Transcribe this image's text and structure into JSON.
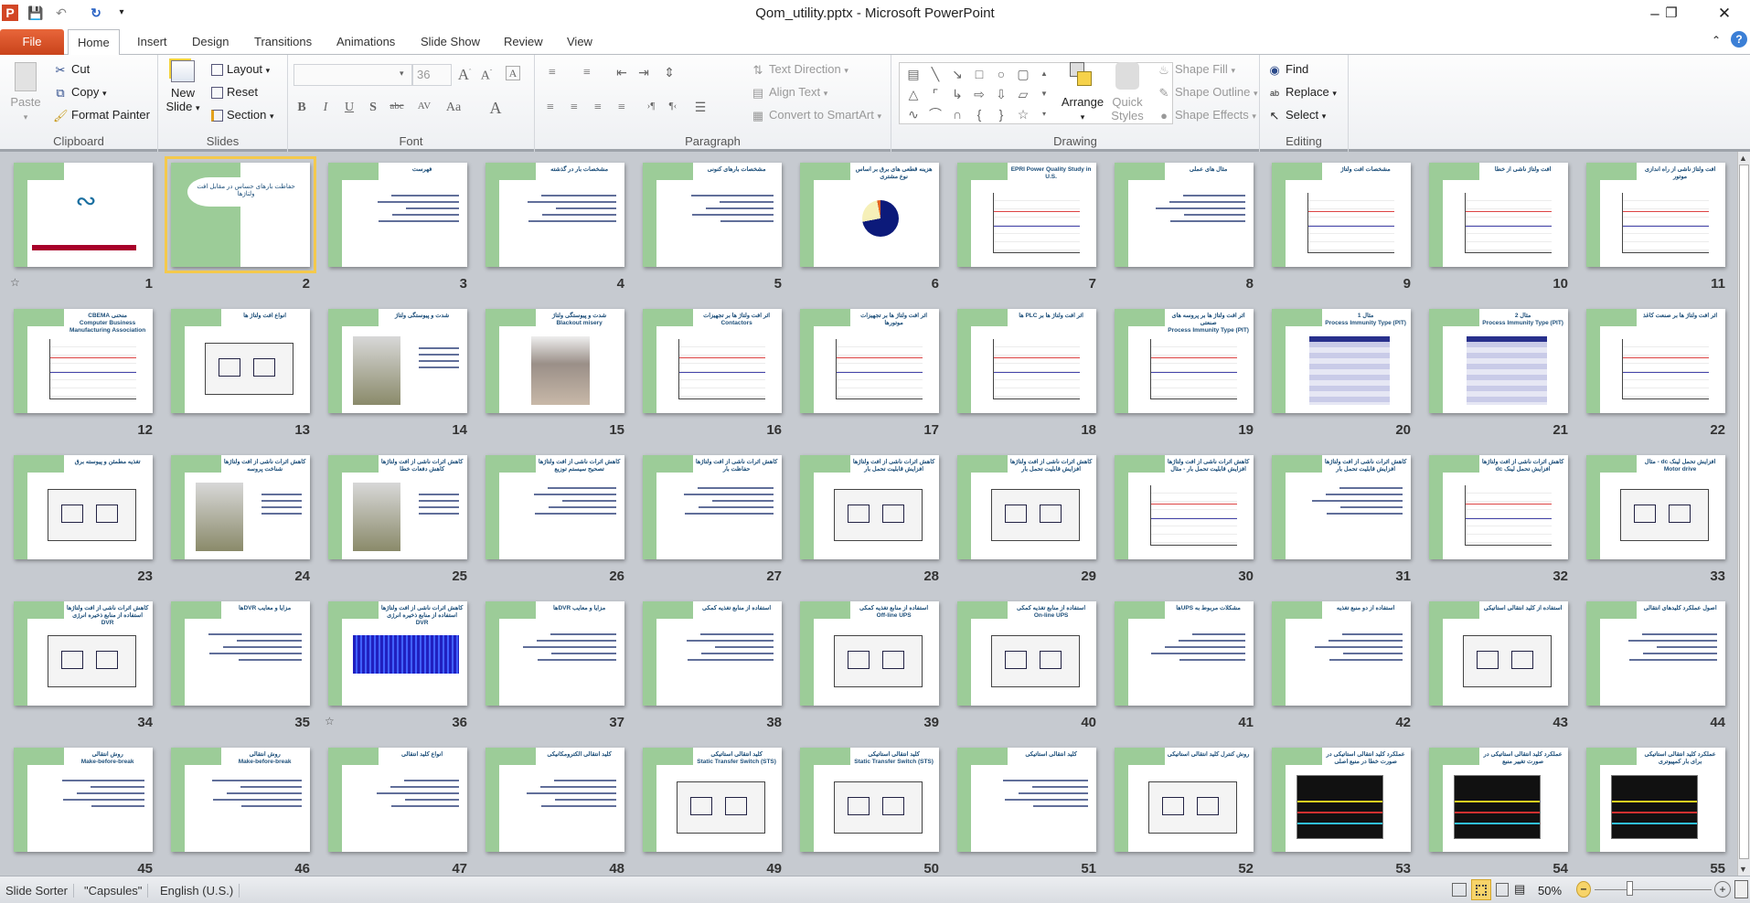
{
  "window": {
    "title": "Qom_utility.pptx - Microsoft PowerPoint",
    "controls": [
      "minimize",
      "restore",
      "close"
    ]
  },
  "qat": {
    "icons": [
      "powerpoint-logo-icon",
      "save-icon",
      "undo-icon",
      "redo-icon",
      "customize-qat-icon"
    ]
  },
  "tabs": [
    {
      "label": "File"
    },
    {
      "label": "Home",
      "active": true
    },
    {
      "label": "Insert"
    },
    {
      "label": "Design"
    },
    {
      "label": "Transitions"
    },
    {
      "label": "Animations"
    },
    {
      "label": "Slide Show"
    },
    {
      "label": "Review"
    },
    {
      "label": "View"
    }
  ],
  "ribbon": {
    "clipboard": {
      "label": "Clipboard",
      "paste": "Paste",
      "cut": "Cut",
      "copy": "Copy",
      "format_painter": "Format Painter"
    },
    "slides": {
      "label": "Slides",
      "new_slide_1": "New",
      "new_slide_2": "Slide",
      "layout": "Layout",
      "reset": "Reset",
      "section": "Section"
    },
    "font": {
      "label": "Font",
      "font_name": "",
      "font_size": "36"
    },
    "paragraph": {
      "label": "Paragraph",
      "text_direction": "Text Direction",
      "align_text": "Align Text",
      "convert_smartart": "Convert to SmartArt"
    },
    "drawing": {
      "label": "Drawing",
      "arrange": "Arrange",
      "quick_1": "Quick",
      "quick_2": "Styles",
      "shape_fill": "Shape Fill",
      "shape_outline": "Shape Outline",
      "shape_effects": "Shape Effects"
    },
    "editing": {
      "label": "Editing",
      "find": "Find",
      "replace": "Replace",
      "select": "Select"
    }
  },
  "slides": [
    {
      "n": "1",
      "title": "",
      "sub": "",
      "anim": true
    },
    {
      "n": "2",
      "title": "حفاظت بارهای حساس در مقابل افت ولتاژها",
      "sub": "",
      "selected": true
    },
    {
      "n": "3",
      "title": "فهرست",
      "sub": ""
    },
    {
      "n": "4",
      "title": "مشخصات بار در گذشته",
      "sub": ""
    },
    {
      "n": "5",
      "title": "مشخصات بارهای کنونی",
      "sub": ""
    },
    {
      "n": "6",
      "title": "هزینه قطعی های برق بر اساس نوع مشتری",
      "sub": ""
    },
    {
      "n": "7",
      "title": "",
      "sub": "EPRI Power Quality Study in U.S."
    },
    {
      "n": "8",
      "title": "مثال های عملی",
      "sub": ""
    },
    {
      "n": "9",
      "title": "مشخصات افت ولتاژ",
      "sub": ""
    },
    {
      "n": "10",
      "title": "افت ولتاژ ناشی از خطا",
      "sub": ""
    },
    {
      "n": "11",
      "title": "افت ولتاژ ناشی از راه اندازی موتور",
      "sub": ""
    },
    {
      "n": "12",
      "title": "منحنی CBEMA",
      "sub": "Computer Business Manufacturing Association"
    },
    {
      "n": "13",
      "title": "انواع افت ولتاژ ها",
      "sub": ""
    },
    {
      "n": "14",
      "title": "شدت و پیوستگی ولتاژ",
      "sub": ""
    },
    {
      "n": "15",
      "title": "شدت و پیوستگی ولتاژ",
      "sub": "Blackout misery"
    },
    {
      "n": "16",
      "title": "اثر افت ولتاژ ها بر تجهیزات",
      "sub": "Contactors"
    },
    {
      "n": "17",
      "title": "اثر افت ولتاژ ها بر تجهیزات موتورها",
      "sub": ""
    },
    {
      "n": "18",
      "title": "اثر افت ولتاژ ها بر PLC ها",
      "sub": ""
    },
    {
      "n": "19",
      "title": "اثر افت ولتاژ ها بر پروسه های صنعتی",
      "sub": "Process Immunity Type (PIT)"
    },
    {
      "n": "20",
      "title": "مثال 1",
      "sub": "Process Immunity Type (PIT)"
    },
    {
      "n": "21",
      "title": "مثال 2",
      "sub": "Process Immunity Type (PIT)"
    },
    {
      "n": "22",
      "title": "اثر افت ولتاژ ها بر صنعت کاغذ",
      "sub": ""
    },
    {
      "n": "23",
      "title": "تغذیه مطمئن و پیوسته برق",
      "sub": ""
    },
    {
      "n": "24",
      "title": "کاهش اثرات ناشی از افت ولتاژها شناخت پروسه",
      "sub": ""
    },
    {
      "n": "25",
      "title": "کاهش اثرات ناشی از افت ولتاژها کاهش دفعات خطا",
      "sub": ""
    },
    {
      "n": "26",
      "title": "کاهش اثرات ناشی از افت ولتاژها تصحیح سیستم توزیع",
      "sub": ""
    },
    {
      "n": "27",
      "title": "کاهش اثرات ناشی از افت ولتاژها حفاظت بار",
      "sub": ""
    },
    {
      "n": "28",
      "title": "کاهش اثرات ناشی از افت ولتاژها افزایش قابلیت تحمل بار",
      "sub": ""
    },
    {
      "n": "29",
      "title": "کاهش اثرات ناشی از افت ولتاژها افزایش قابلیت تحمل بار",
      "sub": ""
    },
    {
      "n": "30",
      "title": "کاهش اثرات ناشی از افت ولتاژها افزایش قابلیت تحمل بار - مثال",
      "sub": ""
    },
    {
      "n": "31",
      "title": "کاهش اثرات ناشی از افت ولتاژها افزایش قابلیت تحمل بار",
      "sub": ""
    },
    {
      "n": "32",
      "title": "کاهش اثرات ناشی از افت ولتاژها افزایش تحمل لینک dc",
      "sub": ""
    },
    {
      "n": "33",
      "title": "افزایش تحمل لینک dc - مثال",
      "sub": "Motor drive"
    },
    {
      "n": "34",
      "title": "کاهش اثرات ناشی از افت ولتاژها استفاده از منابع ذخیره انرژی",
      "sub": "DVR"
    },
    {
      "n": "35",
      "title": "مزایا و معایب DVRها",
      "sub": ""
    },
    {
      "n": "36",
      "title": "کاهش اثرات ناشی از افت ولتاژها استفاده از منابع ذخیره انرژی",
      "sub": "DVR",
      "anim": true
    },
    {
      "n": "37",
      "title": "مزایا و معایب DVRها",
      "sub": ""
    },
    {
      "n": "38",
      "title": "استفاده از منابع تغذیه کمکی",
      "sub": ""
    },
    {
      "n": "39",
      "title": "استفاده از منابع تغذیه کمکی",
      "sub": "Off-line UPS"
    },
    {
      "n": "40",
      "title": "استفاده از منابع تغذیه کمکی",
      "sub": "On-line UPS"
    },
    {
      "n": "41",
      "title": "مشکلات مربوط به UPSها",
      "sub": ""
    },
    {
      "n": "42",
      "title": "استفاده از دو منبع تغذیه",
      "sub": ""
    },
    {
      "n": "43",
      "title": "استفاده از کلید انتقالی استاتیکی",
      "sub": ""
    },
    {
      "n": "44",
      "title": "اصول عملکرد کلیدهای انتقالی",
      "sub": ""
    },
    {
      "n": "45",
      "title": "روش انتقالی",
      "sub": "Make-before-break"
    },
    {
      "n": "46",
      "title": "روش انتقالی",
      "sub": "Make-before-break"
    },
    {
      "n": "47",
      "title": "انواع کلید انتقالی",
      "sub": ""
    },
    {
      "n": "48",
      "title": "کلید انتقالی الکترومکانیکی",
      "sub": ""
    },
    {
      "n": "49",
      "title": "کلید انتقالی استاتیکی",
      "sub": "Static Transfer Switch (STS)"
    },
    {
      "n": "50",
      "title": "کلید انتقالی استاتیکی",
      "sub": "Static Transfer Switch (STS)"
    },
    {
      "n": "51",
      "title": "کلید انتقالی استاتیکی",
      "sub": ""
    },
    {
      "n": "52",
      "title": "روش کنترل کلید انتقالی استاتیکی",
      "sub": ""
    },
    {
      "n": "53",
      "title": "عملکرد کلید انتقالی استاتیکی در صورت خطا در منبع اصلی",
      "sub": ""
    },
    {
      "n": "54",
      "title": "عملکرد کلید انتقالی استاتیکی در صورت تغییر منبع",
      "sub": ""
    },
    {
      "n": "55",
      "title": "عملکرد کلید انتقالی استاتیکی برای بار کمپیوتری",
      "sub": ""
    }
  ],
  "status": {
    "view": "Slide Sorter",
    "theme": "\"Capsules\"",
    "language": "English (U.S.)",
    "zoom": "50%",
    "zoom_percent": 50
  },
  "colors": {
    "accent_green": "#9ccc98",
    "title_blue": "#1d4f7a",
    "selection": "#f4c94c",
    "file_tab": "#d9532a"
  }
}
